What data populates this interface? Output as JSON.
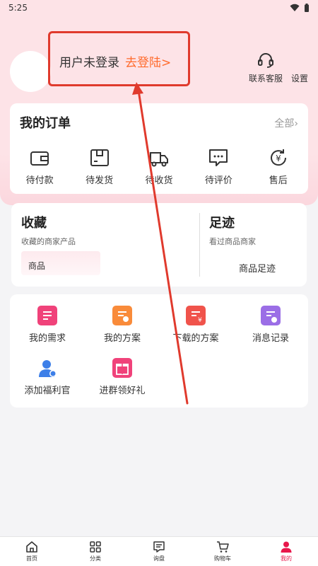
{
  "status_bar": {
    "time": "5:25"
  },
  "profile": {
    "login_status": "用户未登录",
    "login_link": "去登陆>"
  },
  "top_actions": {
    "service_label": "联系客服",
    "settings_label": "设置"
  },
  "orders": {
    "title": "我的订单",
    "all_label": "全部",
    "items": [
      {
        "label": "待付款",
        "icon": "wallet-icon"
      },
      {
        "label": "待发货",
        "icon": "package-icon"
      },
      {
        "label": "待收货",
        "icon": "truck-icon"
      },
      {
        "label": "待评价",
        "icon": "comment-icon"
      },
      {
        "label": "售后",
        "icon": "refund-icon"
      }
    ]
  },
  "favorites": {
    "title": "收藏",
    "subtitle": "收藏的商家产品",
    "chip_label": "商品"
  },
  "footprints": {
    "title": "足迹",
    "subtitle": "看过商品商家",
    "link_label": "商品足迹"
  },
  "tools": [
    {
      "label": "我的需求",
      "icon": "requirement-icon",
      "color": "#f0427a"
    },
    {
      "label": "我的方案",
      "icon": "plan-icon",
      "color": "#f98b3a"
    },
    {
      "label": "下载的方案",
      "icon": "download-plan-icon",
      "color": "#f0534b"
    },
    {
      "label": "消息记录",
      "icon": "message-record-icon",
      "color": "#9b6ee6"
    },
    {
      "label": "添加福利官",
      "icon": "welfare-officer-icon",
      "color": "#3d7fe8"
    },
    {
      "label": "进群领好礼",
      "icon": "gift-icon",
      "color": "#f0427a"
    }
  ],
  "tabbar": [
    {
      "label": "首页",
      "icon": "home-icon"
    },
    {
      "label": "分类",
      "icon": "category-icon"
    },
    {
      "label": "询盘",
      "icon": "inquiry-icon"
    },
    {
      "label": "购物车",
      "icon": "cart-icon"
    },
    {
      "label": "我的",
      "icon": "profile-icon",
      "active": true
    }
  ],
  "colors": {
    "accent": "#e8174b",
    "login_link": "#ff6a2b",
    "annotation": "#e03a2d",
    "header_bg": "#fde3e7"
  }
}
